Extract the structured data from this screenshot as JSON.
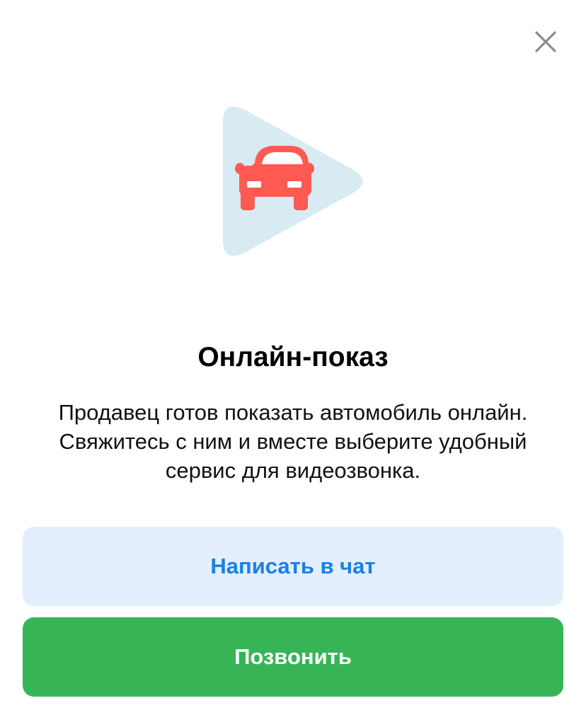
{
  "dialog": {
    "close_icon": "close-icon",
    "illustration_icon": "car-video-icon",
    "title": "Онлайн-показ",
    "description_lines": [
      "Продавец готов показать автомобиль онлайн.",
      "Свяжитесь с ним и вместе выберите удобный",
      "сервис для видеозвонка."
    ]
  },
  "actions": {
    "chat_label": "Написать в чат",
    "call_label": "Позвонить"
  },
  "colors": {
    "play_bg": "#d8eaf2",
    "car": "#ff5a52",
    "chat_bg": "#e3effc",
    "chat_text": "#1a7ff0",
    "call_bg": "#37b556",
    "call_text": "#ffffff",
    "close_icon": "#8c8c8c"
  }
}
